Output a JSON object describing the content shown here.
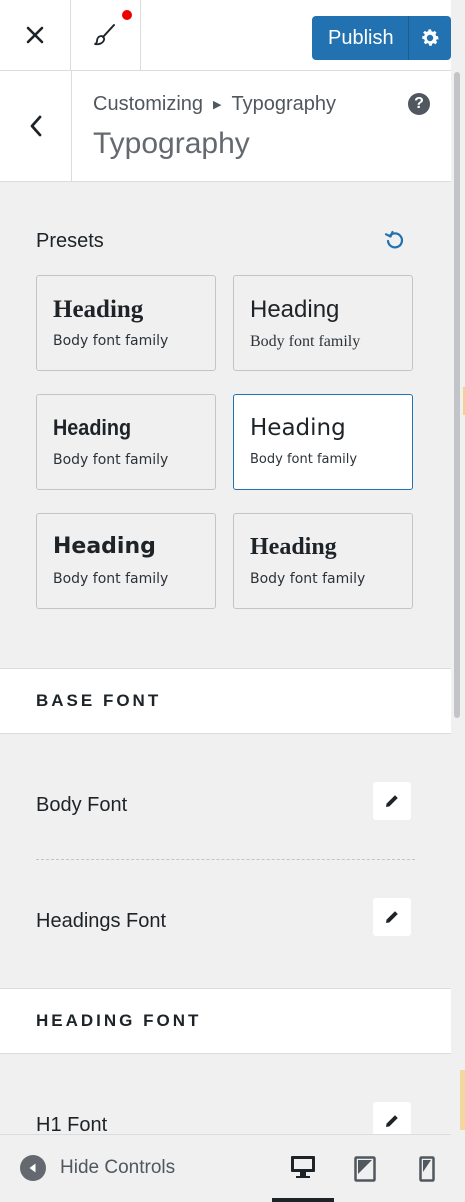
{
  "topbar": {
    "close_icon": "close-icon",
    "brush_icon": "paintbrush-icon",
    "publish_label": "Publish",
    "gear_icon": "gear-icon",
    "accent": "#2271b1"
  },
  "section": {
    "breadcrumb_root": "Customizing",
    "breadcrumb_current": "Typography",
    "title": "Typography",
    "help": "?"
  },
  "presets": {
    "label": "Presets",
    "items": [
      {
        "heading": "Heading",
        "body": "Body font family",
        "selected": false
      },
      {
        "heading": "Heading",
        "body": "Body font family",
        "selected": false
      },
      {
        "heading": "Heading",
        "body": "Body font family",
        "selected": false
      },
      {
        "heading": "Heading",
        "body": "Body font family",
        "selected": true
      },
      {
        "heading": "Heading",
        "body": "Body font family",
        "selected": false
      },
      {
        "heading": "Heading",
        "body": "Body font family",
        "selected": false
      }
    ]
  },
  "base_font": {
    "title": "BASE FONT",
    "rows": [
      "Body Font",
      "Headings Font"
    ]
  },
  "heading_font": {
    "title": "HEADING FONT",
    "rows": [
      "H1 Font"
    ]
  },
  "footer": {
    "hide_controls": "Hide Controls",
    "devices": [
      "desktop-icon",
      "tablet-icon",
      "mobile-icon"
    ]
  }
}
